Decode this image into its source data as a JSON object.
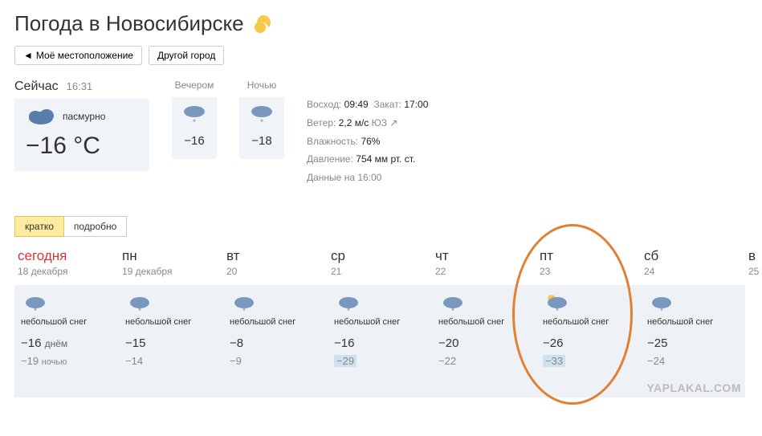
{
  "title": "Погода в Новосибирске",
  "buttons": {
    "location": "Моё местоположение",
    "other": "Другой город"
  },
  "now": {
    "label": "Сейчас",
    "time": "16:31",
    "condition": "пасмурно",
    "temp": "−16 °C",
    "mini": [
      {
        "label": "Вечером",
        "temp": "−16"
      },
      {
        "label": "Ночью",
        "temp": "−18"
      }
    ],
    "details": {
      "sunrise_k": "Восход:",
      "sunrise_v": "09:49",
      "sunset_k": "Закат:",
      "sunset_v": "17:00",
      "wind_k": "Ветер:",
      "wind_v": "2,2 м/с",
      "wind_dir": "ЮЗ",
      "humidity_k": "Влажность:",
      "humidity_v": "76%",
      "pressure_k": "Давление:",
      "pressure_v": "754 мм рт. ст.",
      "data_at": "Данные на 16:00"
    }
  },
  "tabs": {
    "short": "кратко",
    "detailed": "подробно"
  },
  "labels": {
    "day_suffix": "днём",
    "night_suffix": "ночью"
  },
  "forecast": [
    {
      "dow": "сегодня",
      "date": "18 декабря",
      "today": true,
      "cond": "небольшой снег",
      "t_day": "−16",
      "t_night": "−19",
      "cold": false,
      "sun": false
    },
    {
      "dow": "пн",
      "date": "19 декабря",
      "today": false,
      "cond": "небольшой снег",
      "t_day": "−15",
      "t_night": "−14",
      "cold": false,
      "sun": false
    },
    {
      "dow": "вт",
      "date": "20",
      "today": false,
      "cond": "небольшой снег",
      "t_day": "−8",
      "t_night": "−9",
      "cold": false,
      "sun": false
    },
    {
      "dow": "ср",
      "date": "21",
      "today": false,
      "cond": "небольшой снег",
      "t_day": "−16",
      "t_night": "−29",
      "cold": true,
      "sun": false
    },
    {
      "dow": "чт",
      "date": "22",
      "today": false,
      "cond": "небольшой снег",
      "t_day": "−20",
      "t_night": "−22",
      "cold": false,
      "sun": false
    },
    {
      "dow": "пт",
      "date": "23",
      "today": false,
      "cond": "небольшой снег",
      "t_day": "−26",
      "t_night": "−33",
      "cold": true,
      "sun": true
    },
    {
      "dow": "сб",
      "date": "24",
      "today": false,
      "cond": "небольшой снег",
      "t_day": "−25",
      "t_night": "−24",
      "cold": false,
      "sun": false
    },
    {
      "dow": "в",
      "date": "25",
      "today": false,
      "cond": "",
      "t_day": "",
      "t_night": "",
      "cold": false,
      "sun": false,
      "cut": true
    }
  ],
  "watermark": "YAPLAKAL.COM"
}
